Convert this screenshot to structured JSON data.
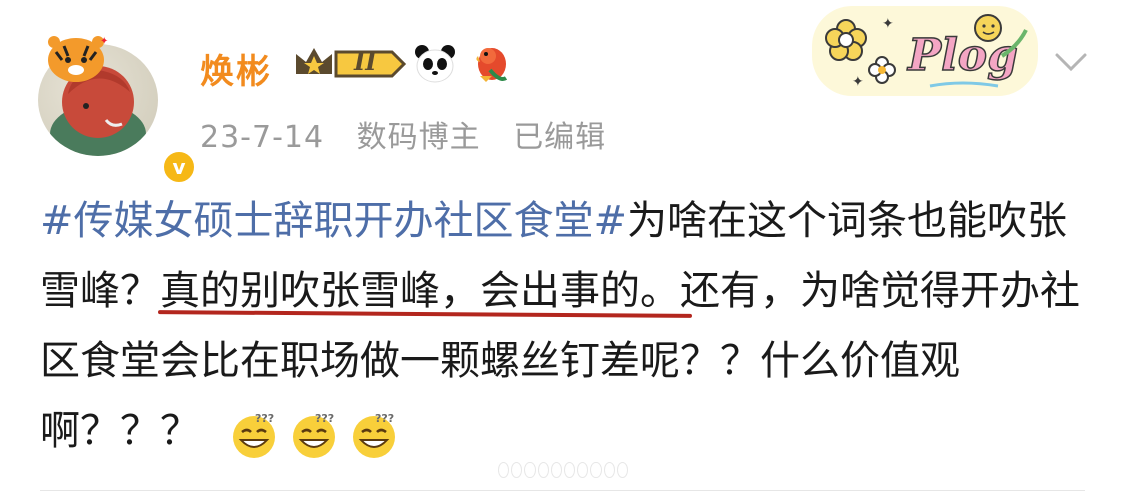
{
  "post": {
    "author": {
      "name": "焕彬",
      "level_badge": "II",
      "verified_icon": "verified-v-icon"
    },
    "meta": {
      "date": "23-7-14",
      "role": "数码博主",
      "edit_status": "已编辑"
    },
    "sticker_text": "Plog",
    "content": {
      "hashtag": "#传媒女硕士辞职开办社区食堂#",
      "text1": "为啥在这个词条也能吹张雪峰？",
      "highlight": "真的别吹张雪峰，会出事的。",
      "text2": "还有，为啥觉得开办社区食堂会比在职场做一颗螺丝钉差呢？？什么价值观啊？？？"
    },
    "emojis": [
      "grin-sweat-icon",
      "grin-sweat-icon",
      "grin-sweat-icon"
    ],
    "colors": {
      "username": "#f28b1e",
      "hashtag": "#4e6ea8",
      "meta": "#9a9a9a",
      "underline": "#b3261e",
      "verified": "#f6b816"
    }
  }
}
